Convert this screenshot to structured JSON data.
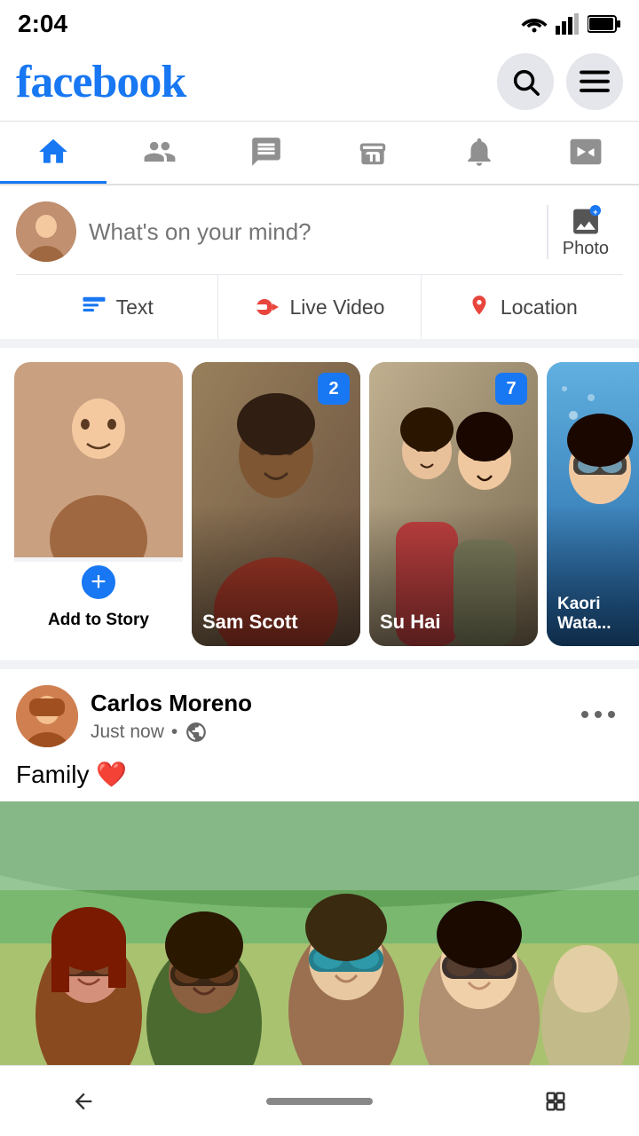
{
  "status": {
    "time": "2:04"
  },
  "header": {
    "logo": "facebook",
    "search_label": "search",
    "menu_label": "menu"
  },
  "nav": {
    "tabs": [
      {
        "id": "home",
        "label": "Home",
        "active": true
      },
      {
        "id": "friends",
        "label": "Friends",
        "active": false
      },
      {
        "id": "messenger",
        "label": "Messenger",
        "active": false
      },
      {
        "id": "marketplace",
        "label": "Marketplace",
        "active": false
      },
      {
        "id": "notifications",
        "label": "Notifications",
        "active": false
      },
      {
        "id": "video",
        "label": "Video",
        "active": false
      }
    ]
  },
  "composer": {
    "placeholder": "What's on your mind?",
    "photo_label": "Photo",
    "text_label": "Text",
    "live_video_label": "Live Video",
    "location_label": "Location"
  },
  "stories": {
    "items": [
      {
        "id": "add",
        "label": "Add to Story",
        "type": "add"
      },
      {
        "id": "sam",
        "name": "Sam Scott",
        "badge": "2"
      },
      {
        "id": "su",
        "name": "Su Hai",
        "badge": "7"
      },
      {
        "id": "kaori",
        "name": "Kaori Wata...",
        "badge": null
      }
    ]
  },
  "post": {
    "author": "Carlos Moreno",
    "time": "Just now",
    "privacy": "public",
    "text": "Family ❤️"
  }
}
